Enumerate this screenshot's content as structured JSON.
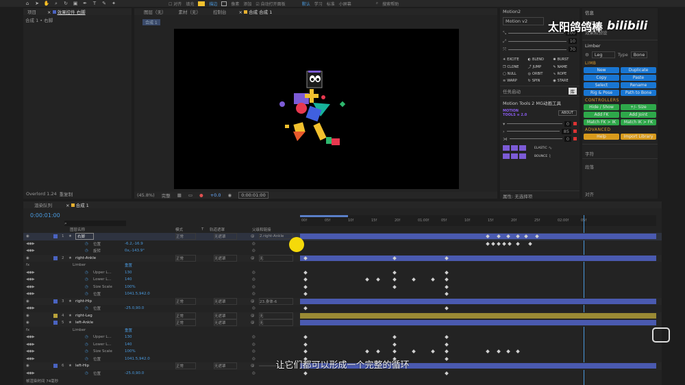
{
  "toolbar": {
    "snap": "对齐",
    "fill": "填充",
    "stroke": "描边",
    "px": "像素",
    "add": "添加",
    "auto_open": "自动打开面板",
    "ws": [
      "默认",
      "学习",
      "标准",
      "小屏幕"
    ],
    "search_ph": "搜索帮助"
  },
  "project": {
    "tabs": [
      "项目",
      "效果控件 右脚"
    ],
    "comp_path": "合成 1 • 右脚",
    "overlord": "Overlord 1.24",
    "undo": "重复制"
  },
  "viewer": {
    "tabs": [
      "图层（无）",
      "素材（无）",
      "控制台",
      "合成 合成 1"
    ],
    "comp_tab": "合成 1",
    "zoom": "(45.8%)",
    "quality": "完整",
    "plus": "+0.0",
    "timecode": "0:00:01:00"
  },
  "motion2": {
    "title": "Motion2",
    "select": "Motion v2",
    "sliders": [
      "100",
      "10",
      "70"
    ],
    "btns": [
      "EXCITE",
      "BLEND",
      "BURST",
      "CLONE",
      "JUMP",
      "NAME",
      "NULL",
      "ORBIT",
      "ROPE",
      "WARP",
      "SPIN",
      "STARE"
    ],
    "task_label": "任务启动",
    "task_btn": "库"
  },
  "mt": {
    "title": "Motion Tools 2 MG动画工具",
    "logo1": "MOTION",
    "logo2": "TOOLS ≡ 2.0",
    "about": "ABOUT",
    "vals": [
      "0",
      "85",
      "0"
    ],
    "elastic": "ELASTIC",
    "bounce": "BOUNCE"
  },
  "info": {
    "title": "信息",
    "items": [
      "音频",
      "效果和预设"
    ],
    "limber": "Limber",
    "leg": "Leg",
    "type_label": "Type",
    "type_val": "Bone",
    "limb": "LIMB",
    "limb_btns": [
      "New",
      "Duplicate",
      "Copy",
      "Paste",
      "Select",
      "Rename",
      "Rig & Pose",
      "Path to Bone"
    ],
    "ctrl": "CONTROLLERS",
    "ctrl_btns": [
      "Hide / Show",
      "+/- Size",
      "Add FK",
      "Add Joint",
      "Match FK > IK",
      "Match IK > FK"
    ],
    "adv": "ADVANCED",
    "adv_btns": [
      "Help",
      "Import Library"
    ],
    "bottom": [
      "字符",
      "段落",
      "对齐"
    ],
    "attr": "属性: 无选择项"
  },
  "brand": {
    "name": "太阳鸽鸽棒",
    "logo": "bilibili"
  },
  "timeline": {
    "tabs": [
      "渲染队列",
      "合成 1"
    ],
    "timecode": "0:00:01:00",
    "cols": [
      "图层名称",
      "模式",
      "T",
      "轨道遮罩",
      "父级和链接"
    ],
    "ticks": [
      "00f",
      "05f",
      "10f",
      "15f",
      "20f",
      "01:00f",
      "05f",
      "10f",
      "15f",
      "20f",
      "25f",
      "02:00f",
      "05f"
    ],
    "footer": "帧渲染时间 74毫秒",
    "layers": [
      {
        "n": "1",
        "name": "右脚",
        "mode": "正常",
        "mat": "无遮罩",
        "parent": "2.right-Ankle",
        "color": "#4a63c0",
        "sel": true
      },
      {
        "p": "位置",
        "v": "-6.2,-16.9"
      },
      {
        "p": "旋转",
        "v": "0x,-143.9°"
      },
      {
        "n": "2",
        "name": "right-Ankle",
        "mode": "正常",
        "mat": "无遮罩",
        "parent": "无",
        "color": "#4a63c0"
      },
      {
        "fx": "Limber",
        "v": "重置"
      },
      {
        "p": "Upper L...",
        "v": "130"
      },
      {
        "p": "Lower L...",
        "v": "140"
      },
      {
        "p": "Size Scale",
        "v": "100%"
      },
      {
        "p": "位置",
        "v": "1041.5,942.0"
      },
      {
        "n": "3",
        "name": "right-Hip",
        "mode": "正常",
        "mat": "无遮罩",
        "parent": "23.身体-6",
        "color": "#4a63c0"
      },
      {
        "p": "位置",
        "v": "-25.0,90.0"
      },
      {
        "n": "4",
        "name": "right-Leg",
        "mode": "正常",
        "mat": "无遮罩",
        "parent": "无",
        "color": "#b8a23a"
      },
      {
        "n": "5",
        "name": "left-Ankle",
        "mode": "正常",
        "mat": "无遮罩",
        "parent": "无",
        "color": "#4a63c0"
      },
      {
        "fx": "Limber",
        "v": "重置"
      },
      {
        "p": "Upper L...",
        "v": "130"
      },
      {
        "p": "Lower L...",
        "v": "140"
      },
      {
        "p": "Size Scale",
        "v": "100%"
      },
      {
        "p": "位置",
        "v": "1041.5,942.0"
      },
      {
        "n": "6",
        "name": "left-Hip",
        "mode": "正常",
        "mat": "无遮罩",
        "parent": "",
        "color": "#4a63c0"
      },
      {
        "p": "位置",
        "v": "-25.0,90.0"
      }
    ]
  },
  "subtitle": "让它们都可以形成一个完整的循环"
}
